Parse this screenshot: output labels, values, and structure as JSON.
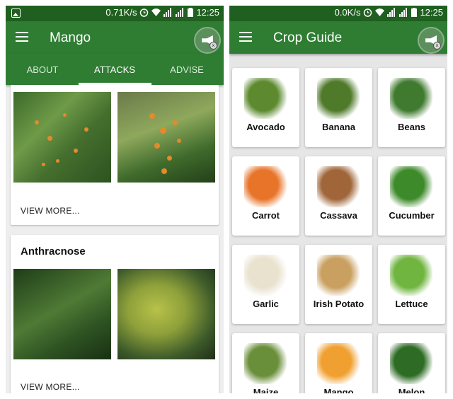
{
  "status_left": {
    "speed": "0.71K/s",
    "time": "12:25"
  },
  "status_right": {
    "speed": "0.0K/s",
    "time": "12:25"
  },
  "left": {
    "title": "Mango",
    "tabs": [
      {
        "label": "ABOUT"
      },
      {
        "label": "ATTACKS"
      },
      {
        "label": "ADVISE"
      }
    ],
    "cards": [
      {
        "title": "",
        "view_more": "VIEW MORE..."
      },
      {
        "title": "Anthracnose",
        "view_more": "VIEW MORE..."
      }
    ]
  },
  "right": {
    "title": "Crop Guide",
    "crops": [
      {
        "name": "Avocado",
        "color": "#5d8a2f"
      },
      {
        "name": "Banana",
        "color": "#4f7a2a"
      },
      {
        "name": "Beans",
        "color": "#3f7a2e"
      },
      {
        "name": "Carrot",
        "color": "#e8742a"
      },
      {
        "name": "Cassava",
        "color": "#a0663a"
      },
      {
        "name": "Cucumber",
        "color": "#3d8a2a"
      },
      {
        "name": "Garlic",
        "color": "#e9e2cf"
      },
      {
        "name": "Irish Potato",
        "color": "#c9a060"
      },
      {
        "name": "Lettuce",
        "color": "#6fb53f"
      },
      {
        "name": "Maize",
        "color": "#6a8f3a"
      },
      {
        "name": "Mango",
        "color": "#f0a030"
      },
      {
        "name": "Melon",
        "color": "#2e6b25"
      }
    ]
  }
}
